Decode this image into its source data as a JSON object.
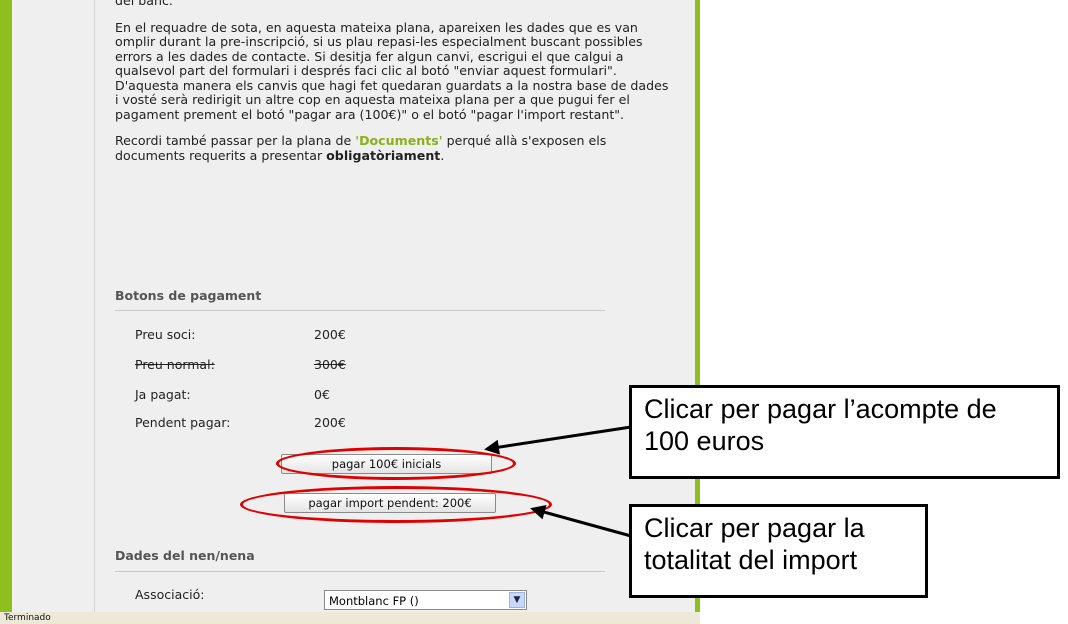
{
  "intro": {
    "clipped_line": "del banc.",
    "para1": "En el requadre de sota, en aquesta mateixa plana, apareixen les dades que es van omplir durant la pre-inscripció, si us plau repasi-les especialment buscant possibles errors a les dades de contacte. Si desitja fer algun canvi, escrigui el que calgui a qualsevol part del formulari i després faci clic al botó \"enviar aquest formulari\". D'aquesta manera els canvis que hagi fet quedaran guardats a la nostra base de dades i vosté serà redirigit un altre cop en aquesta mateixa plana per a que pugui fer el pagament prement el botó \"pagar ara (100€)\" o el botó \"pagar l'import restant\".",
    "para2_before": "Recordi també passar per la plana de ",
    "para2_link": "'Documents'",
    "para2_middle": " perqué allà s'exposen els documents requerits a presentar ",
    "para2_bold": "obligatòriament",
    "para2_after": "."
  },
  "payment": {
    "title": "Botons de pagament",
    "rows": [
      {
        "label": "Preu soci:",
        "value": "200€"
      },
      {
        "label": "Preu normal:",
        "value": "300€"
      },
      {
        "label": "Ja pagat:",
        "value": "0€"
      },
      {
        "label": "Pendent pagar:",
        "value": "200€"
      }
    ],
    "btn_initial": "pagar 100€ inicials",
    "btn_pending": "pagar import pendent: 200€"
  },
  "child": {
    "title": "Dades del nen/nena",
    "assoc_label": "Associació:",
    "assoc_value": "Montblanc FP ()"
  },
  "status": "Terminado",
  "callouts": {
    "top": "Clicar per pagar l’acompte de 100 euros",
    "bottom": "Clicar per pagar la totalitat del import"
  },
  "colors": {
    "frame": "#8fbf1f",
    "link": "#8ab01a",
    "highlight": "#e00000"
  }
}
